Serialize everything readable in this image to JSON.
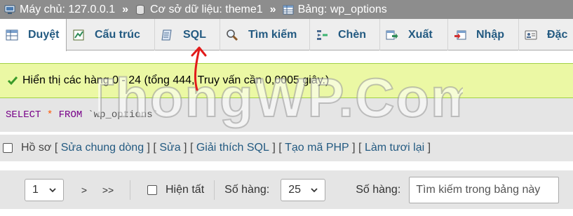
{
  "breadcrumb": [
    {
      "label": "Máy chủ: 127.0.0.1",
      "icon": "server-icon"
    },
    {
      "label": "Cơ sở dữ liệu: theme1",
      "icon": "database-icon"
    },
    {
      "label": "Bảng: wp_options",
      "icon": "table-icon"
    }
  ],
  "breadcrumb_separator": "»",
  "tabs": [
    {
      "label": "Duyệt",
      "icon": "browse-icon",
      "active": true
    },
    {
      "label": "Cấu trúc",
      "icon": "structure-icon"
    },
    {
      "label": "SQL",
      "icon": "sql-icon"
    },
    {
      "label": "Tìm kiếm",
      "icon": "search-icon"
    },
    {
      "label": "Chèn",
      "icon": "insert-icon"
    },
    {
      "label": "Xuất",
      "icon": "export-icon"
    },
    {
      "label": "Nhập",
      "icon": "import-icon"
    },
    {
      "label": "Đặc",
      "icon": "privileges-icon"
    }
  ],
  "message": "Hiển thị các hàng 0 - 24 (tổng 444, Truy vấn cần 0,0005 giây.)",
  "sql": {
    "select": "SELECT",
    "star": "*",
    "from": "FROM",
    "table": "`wp_options`"
  },
  "options": {
    "profile_label": "Hồ sơ",
    "links": [
      "Sửa chung dòng",
      "Sửa",
      "Giải thích SQL",
      "Tạo mã PHP",
      "Làm tươi lại"
    ]
  },
  "nav": {
    "page_value": "1",
    "next": ">",
    "last": ">>",
    "show_all": "Hiện tất",
    "rows_label": "Số hàng:",
    "rows_value": "25",
    "search_label": "Số hàng:",
    "search_placeholder": "Tìm kiếm trong bảng này"
  },
  "watermark": "ThongWP.Com",
  "colors": {
    "breadcrumb_bg": "#8d8d8d",
    "tab_text": "#235a81",
    "success_bg": "#ebf8a4",
    "success_border": "#a2d246",
    "sql_keyword": "#770088",
    "sql_star": "#ff5500",
    "annotation_red": "#e21b1b"
  }
}
